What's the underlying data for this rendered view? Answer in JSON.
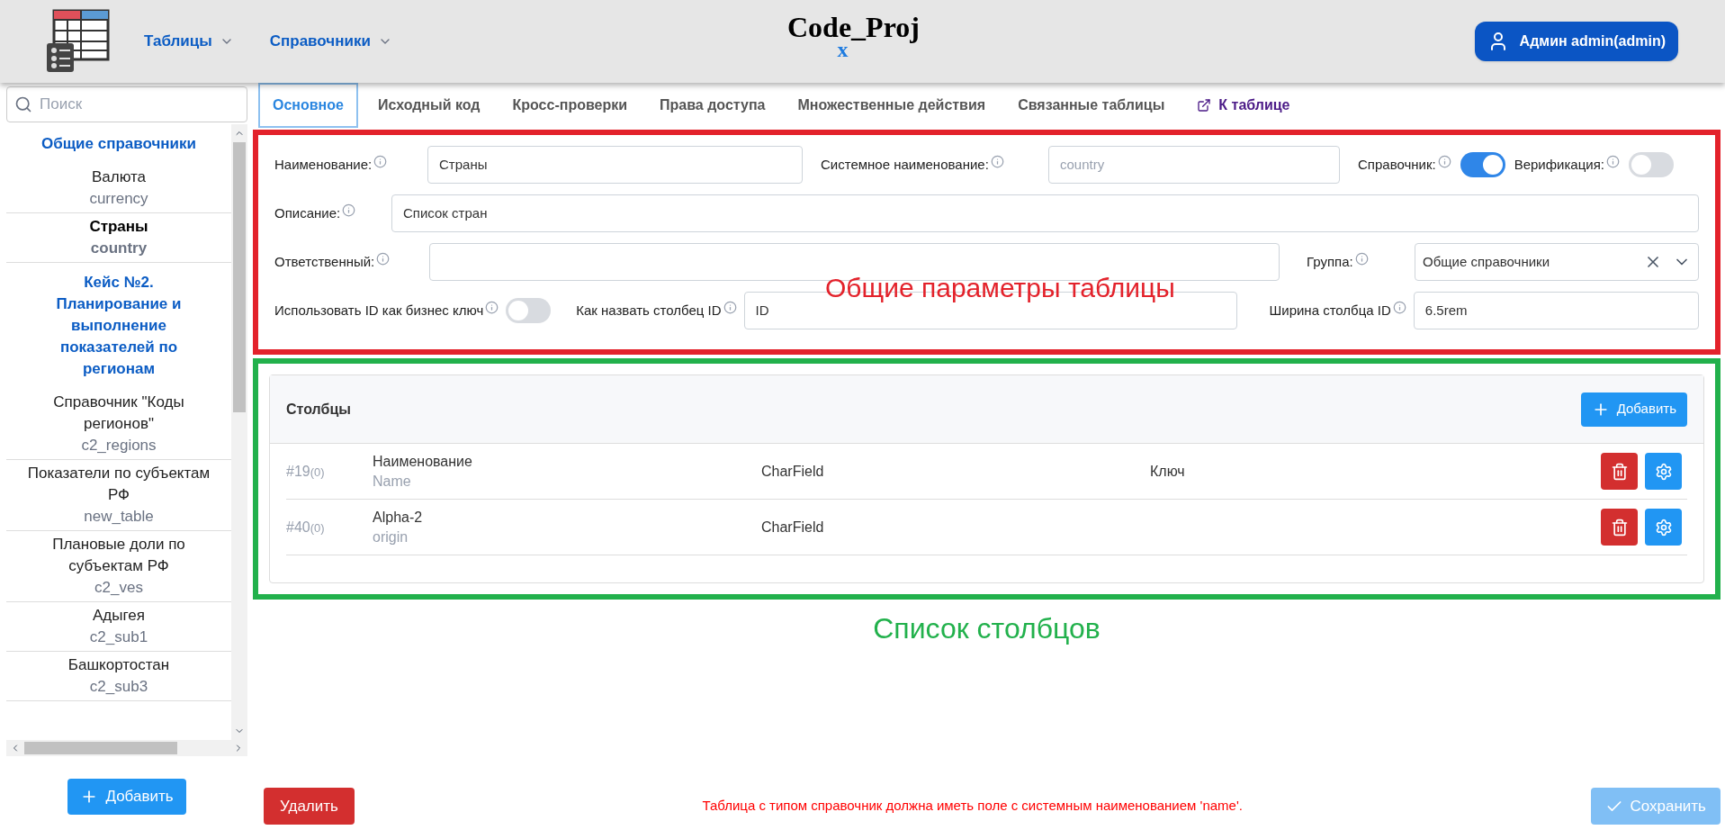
{
  "header": {
    "menus": [
      {
        "label": "Таблицы"
      },
      {
        "label": "Справочники"
      }
    ],
    "logo": {
      "text": "Code_Proj",
      "sub": "x"
    },
    "user": "Админ admin(admin)"
  },
  "sidebar": {
    "search_placeholder": "Поиск",
    "items": [
      {
        "kind": "group",
        "title": "Общие справочники"
      },
      {
        "kind": "item",
        "title": "Валюта",
        "code": "currency",
        "selected": false
      },
      {
        "kind": "item",
        "title": "Страны",
        "code": "country",
        "selected": true
      },
      {
        "kind": "group",
        "title": "Кейс №2. Планирование и выполнение показателей по регионам"
      },
      {
        "kind": "item",
        "title": "Справочник \"Коды регионов\"",
        "code": "c2_regions",
        "selected": false
      },
      {
        "kind": "item",
        "title": "Показатели по субъектам РФ",
        "code": "new_table",
        "selected": false
      },
      {
        "kind": "item",
        "title": "Плановые доли по субъектам РФ",
        "code": "c2_ves",
        "selected": false
      },
      {
        "kind": "item",
        "title": "Адыгея",
        "code": "c2_sub1",
        "selected": false
      },
      {
        "kind": "item",
        "title": "Башкортостан",
        "code": "c2_sub3",
        "selected": false
      }
    ],
    "add_button": "Добавить"
  },
  "tabs": [
    {
      "label": "Основное",
      "selected": true
    },
    {
      "label": "Исходный код",
      "selected": false
    },
    {
      "label": "Кросс-проверки",
      "selected": false
    },
    {
      "label": "Права доступа",
      "selected": false
    },
    {
      "label": "Множественные действия",
      "selected": false
    },
    {
      "label": "Связанные таблицы",
      "selected": false
    }
  ],
  "table_link": "К таблице",
  "form": {
    "name_label": "Наименование:",
    "name_value": "Страны",
    "sys_label": "Системное наименование:",
    "sys_value": "country",
    "ref_label": "Справочник:",
    "ref_on": true,
    "verif_label": "Верификация:",
    "verif_on": false,
    "desc_label": "Описание:",
    "desc_value": "Список стран",
    "owner_label": "Ответственный:",
    "group_label": "Группа:",
    "group_value": "Общие справочники",
    "id_key_label": "Использовать ID как бизнес ключ",
    "id_key_on": false,
    "id_name_label": "Как назвать столбец ID",
    "id_name_value": "ID",
    "id_width_label": "Ширина столбца ID",
    "id_width_value": "6.5rem"
  },
  "annotation_params": "Общие параметры таблицы",
  "columns": {
    "title": "Столбцы",
    "add_button": "Добавить",
    "rows": [
      {
        "id": "#19",
        "count": "(0)",
        "name": "Наименование",
        "sys": "Name",
        "type": "CharField",
        "key": "Ключ"
      },
      {
        "id": "#40",
        "count": "(0)",
        "name": "Alpha-2",
        "sys": "origin",
        "type": "CharField"
      }
    ]
  },
  "annotation_columns": "Список столбцов",
  "footer": {
    "delete_button": "Удалить",
    "message": "Таблица с типом справочник должна иметь поле с системным наименованием 'name'.",
    "save_button": "Сохранить",
    "save_disabled": true
  }
}
